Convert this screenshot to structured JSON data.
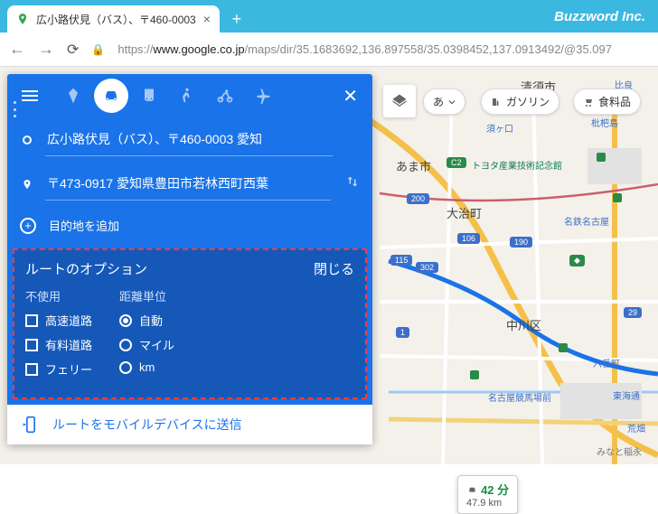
{
  "browser": {
    "tab_title": "広小路伏見（バス）、〒460-0003",
    "brand": "Buzzword Inc.",
    "url_scheme": "https://",
    "url_host": "www.google.co.jp",
    "url_path": "/maps/dir/35.1683692,136.897558/35.0398452,137.0913492/@35.097"
  },
  "panel": {
    "origin": "広小路伏見（バス）、〒460-0003 愛知",
    "destination": "〒473-0917 愛知県豊田市若林西町西葉",
    "add_destination": "目的地を追加"
  },
  "options": {
    "title": "ルートのオプション",
    "close": "閉じる",
    "avoid_header": "不使用",
    "avoid_highways": "高速道路",
    "avoid_tolls": "有料道路",
    "avoid_ferries": "フェリー",
    "units_header": "距離単位",
    "units_auto": "自動",
    "units_miles": "マイル",
    "units_km": "km"
  },
  "send": {
    "label": "ルートをモバイルデバイスに送信"
  },
  "chips": {
    "lang": "あ",
    "gas": "ガソリン",
    "grocery": "食料品"
  },
  "eta": {
    "time": "42 分",
    "distance": "47.9 km"
  },
  "map_labels": {
    "kiyosu": "清須市",
    "ama": "あま市",
    "oharu": "大治町",
    "nakagawa": "中川区",
    "sukaguchi": "須ヶ口",
    "hibitsu": "比良",
    "hibino": "枇杷島",
    "toyota_museum": "トヨタ産業技術記念館",
    "meitetsu": "名鉄名古屋",
    "nagoya_racecourse": "名古屋競馬場前",
    "tokai": "東海通",
    "rokuban": "六番町",
    "arahata": "荒畑"
  },
  "roads": {
    "r302": "302",
    "r106": "106",
    "r190": "190",
    "r29": "29",
    "r1": "1",
    "r115": "115",
    "r200": "200",
    "c2": "C2"
  }
}
